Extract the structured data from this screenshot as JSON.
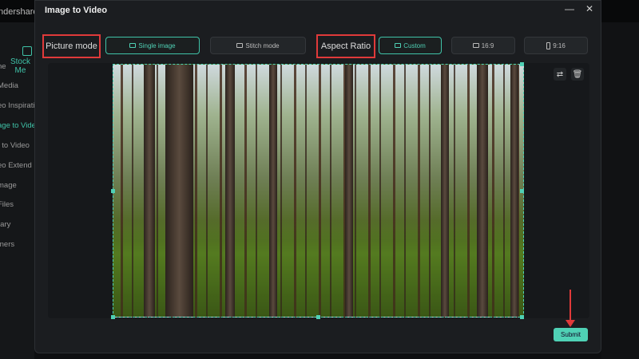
{
  "background_app": {
    "title": "ndershare Fi",
    "stock_label": "Stock Me",
    "sidebar": [
      "ne",
      "Media",
      "eo Inspirati",
      "age to Video",
      "t to Video",
      "eo Extend",
      "mage",
      "Files",
      "rary",
      "tners"
    ]
  },
  "dialog": {
    "title": "Image to Video",
    "minimize": "—",
    "close": "✕",
    "picture_mode_label": "Picture mode",
    "single_image": "Single image",
    "stitch_mode": "Stitch mode",
    "aspect_ratio_label": "Aspect Ratio",
    "custom": "Custom",
    "ratio_16_9": "16:9",
    "ratio_9_16": "9:16",
    "submit": "Submit"
  },
  "colors": {
    "accent": "#4fd1b5",
    "highlight": "#e03a3a"
  }
}
